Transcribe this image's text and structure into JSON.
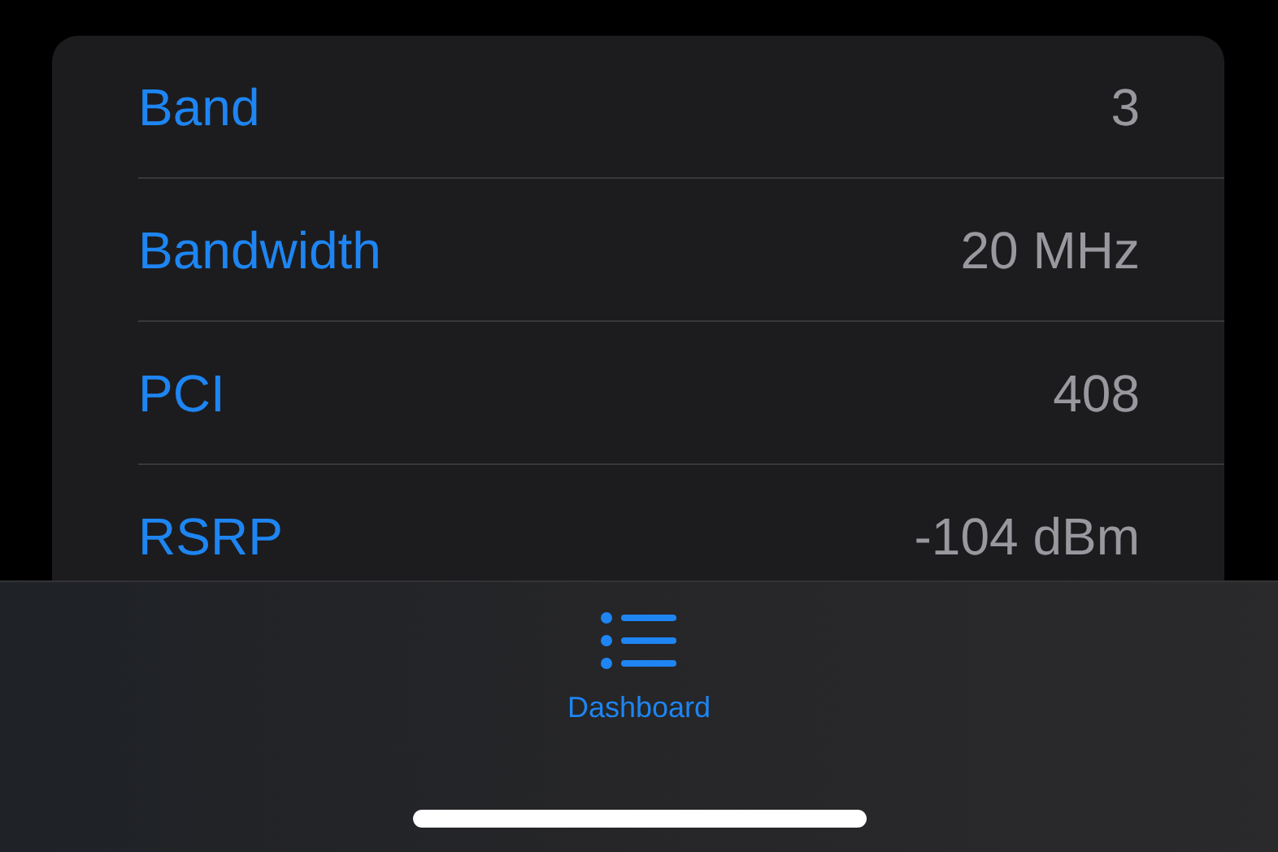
{
  "rows": [
    {
      "label": "Band",
      "value": "3"
    },
    {
      "label": "Bandwidth",
      "value": "20 MHz"
    },
    {
      "label": "PCI",
      "value": "408"
    },
    {
      "label": "RSRP",
      "value": "-104 dBm"
    }
  ],
  "tab_bar": {
    "tabs": [
      {
        "label": "Dashboard",
        "selected": true
      }
    ]
  }
}
